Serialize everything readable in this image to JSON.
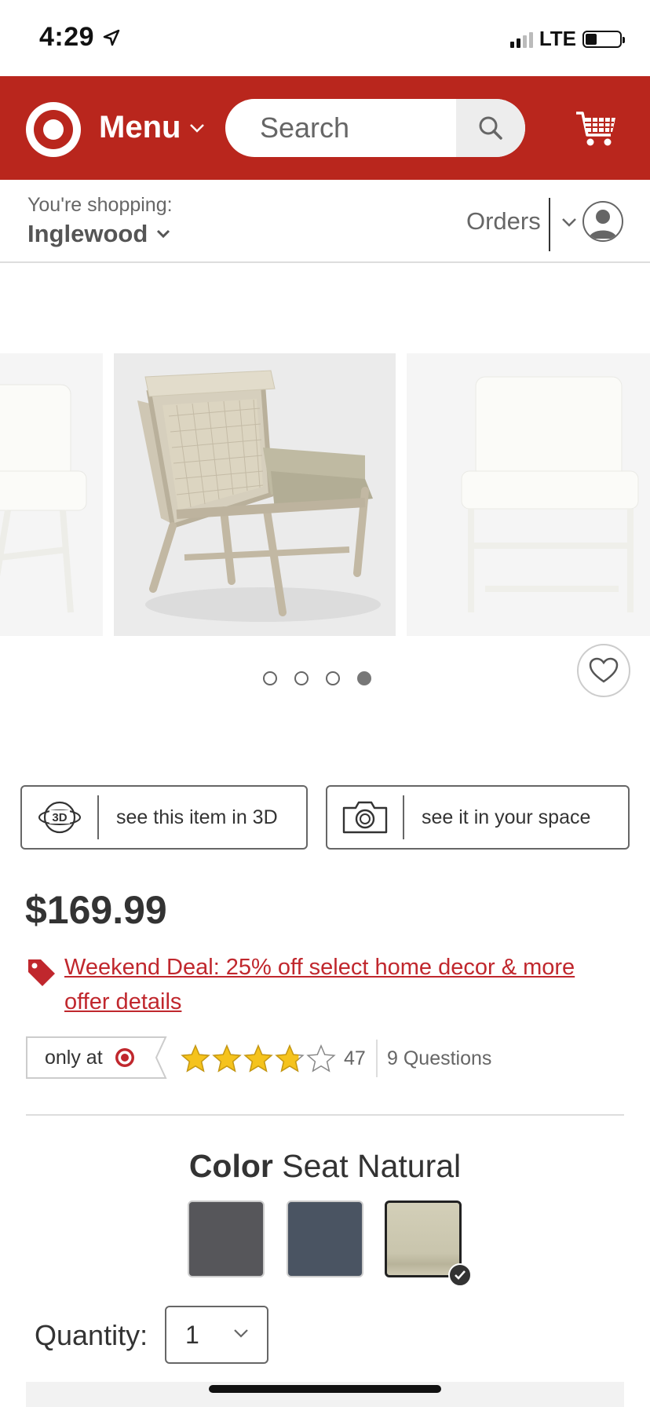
{
  "status_bar": {
    "time": "4:29",
    "network": "LTE",
    "icons": [
      "location-arrow-icon",
      "signal-icon",
      "battery-icon"
    ]
  },
  "header": {
    "logo": "target-bullseye-icon",
    "menu_label": "Menu",
    "search_placeholder": "Search",
    "icons": [
      "chevron-down-icon",
      "search-icon",
      "cart-icon"
    ],
    "brand_color": "#b9261d"
  },
  "store_bar": {
    "shopping_label": "You're shopping:",
    "store_name": "Inglewood",
    "orders_label": "Orders"
  },
  "gallery": {
    "dot_count": 4,
    "active_dot": 4
  },
  "features": {
    "view_3d_label": "see this item in 3D",
    "view_3d_icon_text": "3D",
    "in_space_label": "see it in your space"
  },
  "pricing": {
    "price": "$169.99",
    "deal_line1": "Weekend Deal: 25% off select home decor & more",
    "deal_line2": "offer details",
    "deal_color": "#c0272d"
  },
  "rating": {
    "only_at_label": "only at",
    "stars": 3.8,
    "max_stars": 5,
    "count": "47",
    "questions": "9 Questions"
  },
  "color": {
    "label": "Color",
    "selected": "Seat Natural",
    "swatches": [
      {
        "name": "charcoal",
        "hex": "#56565a"
      },
      {
        "name": "navy",
        "hex": "#4a5462"
      },
      {
        "name": "natural",
        "hex": "#c9c5ad",
        "selected": true
      }
    ]
  },
  "quantity": {
    "label": "Quantity:",
    "value": "1"
  }
}
